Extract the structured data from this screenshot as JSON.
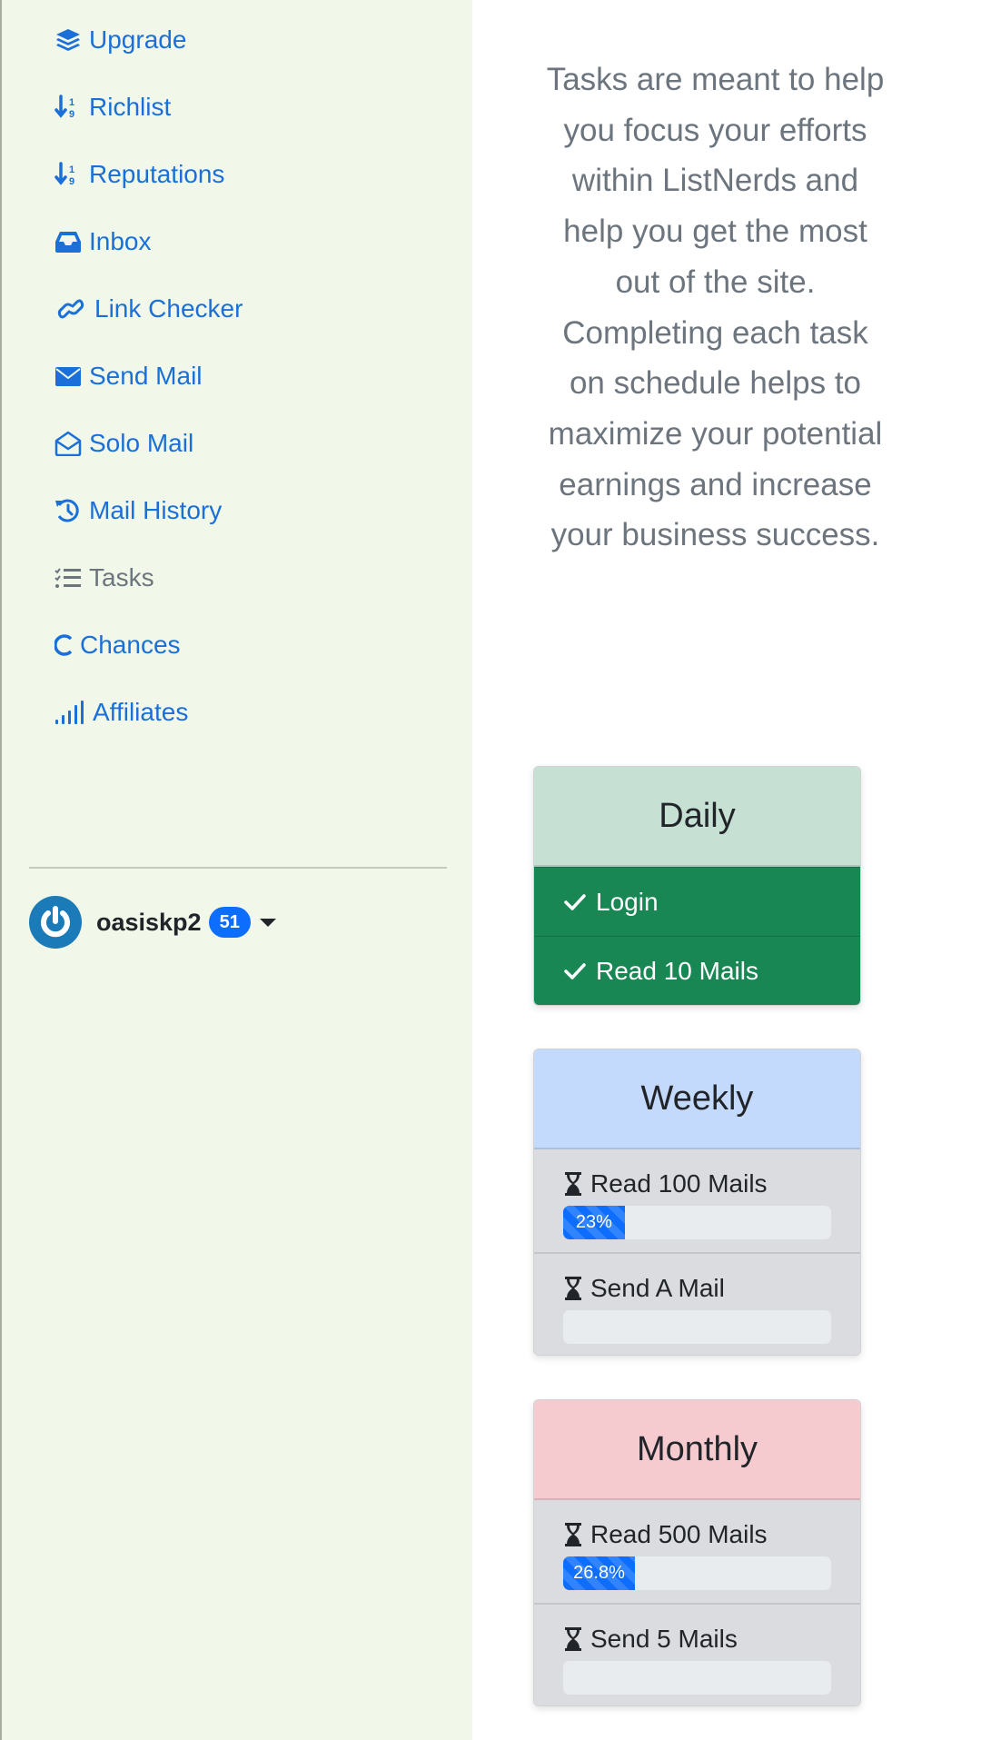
{
  "sidebar": {
    "nav_items": [
      {
        "label": "Upgrade",
        "icon": "layers-icon",
        "active": false
      },
      {
        "label": "Richlist",
        "icon": "sort-numeric-down-icon",
        "active": false
      },
      {
        "label": "Reputations",
        "icon": "sort-numeric-down-icon",
        "active": false
      },
      {
        "label": "Inbox",
        "icon": "inbox-icon",
        "active": false
      },
      {
        "label": "Link Checker",
        "icon": "link-icon",
        "active": false
      },
      {
        "label": "Send Mail",
        "icon": "envelope-icon",
        "active": false
      },
      {
        "label": "Solo Mail",
        "icon": "envelope-open-icon",
        "active": false
      },
      {
        "label": "Mail History",
        "icon": "history-icon",
        "active": false
      },
      {
        "label": "Tasks",
        "icon": "list-check-icon",
        "active": true
      },
      {
        "label": "Chances",
        "icon": "c-icon",
        "active": false
      },
      {
        "label": "Affiliates",
        "icon": "signal-bars-icon",
        "active": false
      }
    ],
    "user": {
      "username": "oasiskp2",
      "badge_count": "51",
      "avatar_icon": "power-icon"
    },
    "colors": {
      "link": "#1a6fd8",
      "active": "#6c757d",
      "background": "#f1f8ea"
    }
  },
  "main": {
    "intro_text": "Tasks are meant to help you focus your efforts within ListNerds and help you get the most out of the site. Completing each task on schedule helps to maximize your potential earnings and increase your business success.",
    "cards": {
      "daily": {
        "title": "Daily",
        "tasks": [
          {
            "label": "Login",
            "status": "complete"
          },
          {
            "label": "Read 10 Mails",
            "status": "complete"
          }
        ]
      },
      "weekly": {
        "title": "Weekly",
        "tasks": [
          {
            "label": "Read 100 Mails",
            "status": "in-progress",
            "progress_percent": 23,
            "progress_label": "23%"
          },
          {
            "label": "Send A Mail",
            "status": "in-progress",
            "progress_percent": 0,
            "progress_label": ""
          }
        ]
      },
      "monthly": {
        "title": "Monthly",
        "tasks": [
          {
            "label": "Read 500 Mails",
            "status": "in-progress",
            "progress_percent": 26.8,
            "progress_label": "26.8%"
          },
          {
            "label": "Send 5 Mails",
            "status": "in-progress",
            "progress_percent": 0,
            "progress_label": ""
          }
        ]
      }
    },
    "colors": {
      "daily_header": "#c6e0d4",
      "weekly_header": "#c4dafc",
      "monthly_header": "#f5cbd0",
      "complete": "#198754",
      "progress": "#0d6efd"
    }
  }
}
